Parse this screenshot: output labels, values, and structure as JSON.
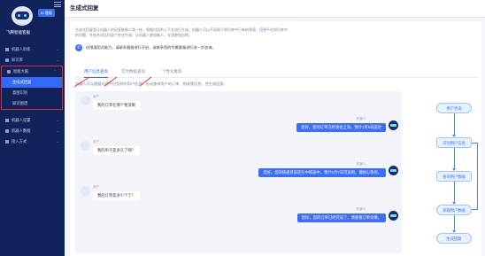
{
  "app": {
    "title": "飞腾智能客服",
    "badge": "AI 客服"
  },
  "sidebar": {
    "items": [
      {
        "label": "机器人训练",
        "icon": "robot-icon"
      },
      {
        "label": "知识库",
        "icon": "book-icon"
      },
      {
        "label": "智能大脑",
        "icon": "brain-icon"
      },
      {
        "label": "机器人设置",
        "icon": "gear-icon"
      },
      {
        "label": "机器人数据",
        "icon": "chart-icon"
      },
      {
        "label": "接入方式",
        "icon": "plug-icon"
      }
    ],
    "sub_items": [
      {
        "label": "生成式回复",
        "active": true
      },
      {
        "label": "意图识别"
      },
      {
        "label": "知识图谱"
      }
    ]
  },
  "header": {
    "title": "生成式回复"
  },
  "card": {
    "description": "生成式回复是让机器人的回复能像人类一样，根据对话的上下文进行生成，机器人可以不局限于知识库中已有的答案，回答不在知识库中的问题，并结合对话内容个性化生成，让机器人更加像人，交流更加自然。",
    "tip": "仅限通用式能力，请联系客服进行开启，或联系您的专属客服进行进一步咨询。",
    "tip_icon": "phone-icon",
    "tabs": [
      "用户信息查询",
      "实时数据查询",
      "个性化推荐"
    ],
    "active_tab": 0,
    "tab_hint": "机器人可以根据对话中识别到的用户信息，自动查询用户的订单、物流等信息，并生成回复。"
  },
  "chat": {
    "user_label": "用户",
    "bot_label": "机器人",
    "messages": [
      {
        "from": "user",
        "text": "我的订单在哪个物流啊"
      },
      {
        "from": "bot",
        "text": "您好，您的订单已经发往上海，预计1月5日送达"
      },
      {
        "from": "user",
        "text": "我的单子是多久了啊？"
      },
      {
        "from": "bot",
        "text": "您好，您的快递目前还在中转途中，预计1月7日可送到，请耐心等待。"
      },
      {
        "from": "user",
        "text": "我的订单是多少个了？"
      },
      {
        "from": "bot",
        "text": "您好，您的订单已经完成了，请查看订单详情。"
      }
    ]
  },
  "flow": {
    "nodes": [
      "用户咨询",
      "识别用户信息",
      "查询用户数据",
      "获取用户数据",
      "生成回复"
    ]
  }
}
